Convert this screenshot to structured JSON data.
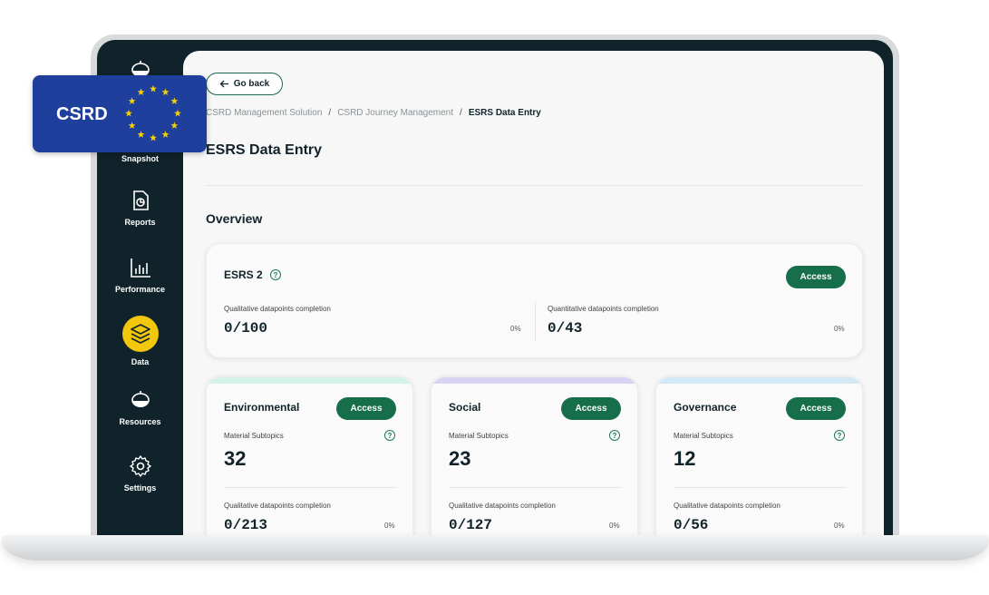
{
  "sidebar": {
    "items": [
      {
        "label": "Snapshot",
        "icon": "lamp-icon"
      },
      {
        "label": "Reports",
        "icon": "report-icon"
      },
      {
        "label": "Performance",
        "icon": "bar-chart-icon"
      },
      {
        "label": "Data",
        "icon": "layers-icon",
        "active": true
      },
      {
        "label": "Resources",
        "icon": "lamp-icon"
      },
      {
        "label": "Settings",
        "icon": "gear-icon"
      }
    ]
  },
  "badge": {
    "label": "CSRD",
    "colors": {
      "background": "#1f3f9c",
      "stars": "#f6d200"
    }
  },
  "header": {
    "go_back": "Go back",
    "breadcrumb": [
      "CSRD Management Solution",
      "CSRD Journey Management",
      "ESRS Data Entry"
    ],
    "title": "ESRS Data Entry"
  },
  "overview": {
    "title": "Overview",
    "esrs2": {
      "title": "ESRS 2",
      "access": "Access",
      "qualitative_label": "Qualitative datapoints completion",
      "qualitative_value": "0/100",
      "qualitative_pct": "0%",
      "quantitative_label": "Quantitative datapoints completion",
      "quantitative_value": "0/43",
      "quantitative_pct": "0%"
    },
    "topics": [
      {
        "title": "Environmental",
        "access": "Access",
        "subtopics_label": "Material Subtopics",
        "subtopics": "32",
        "qual_label": "Qualitative datapoints completion",
        "qual_value": "0/213",
        "qual_pct": "0%",
        "accent": "#d3f3e6"
      },
      {
        "title": "Social",
        "access": "Access",
        "subtopics_label": "Material Subtopics",
        "subtopics": "23",
        "qual_label": "Qualitative datapoints completion",
        "qual_value": "0/127",
        "qual_pct": "0%",
        "accent": "#d7d4f5"
      },
      {
        "title": "Governance",
        "access": "Access",
        "subtopics_label": "Material Subtopics",
        "subtopics": "12",
        "qual_label": "Qualitative datapoints completion",
        "qual_value": "0/56",
        "qual_pct": "0%",
        "accent": "#d3e9f5"
      }
    ]
  },
  "colors": {
    "sidebar": "#10232a",
    "primary": "#166e4b",
    "active_nav": "#f2c70c"
  }
}
